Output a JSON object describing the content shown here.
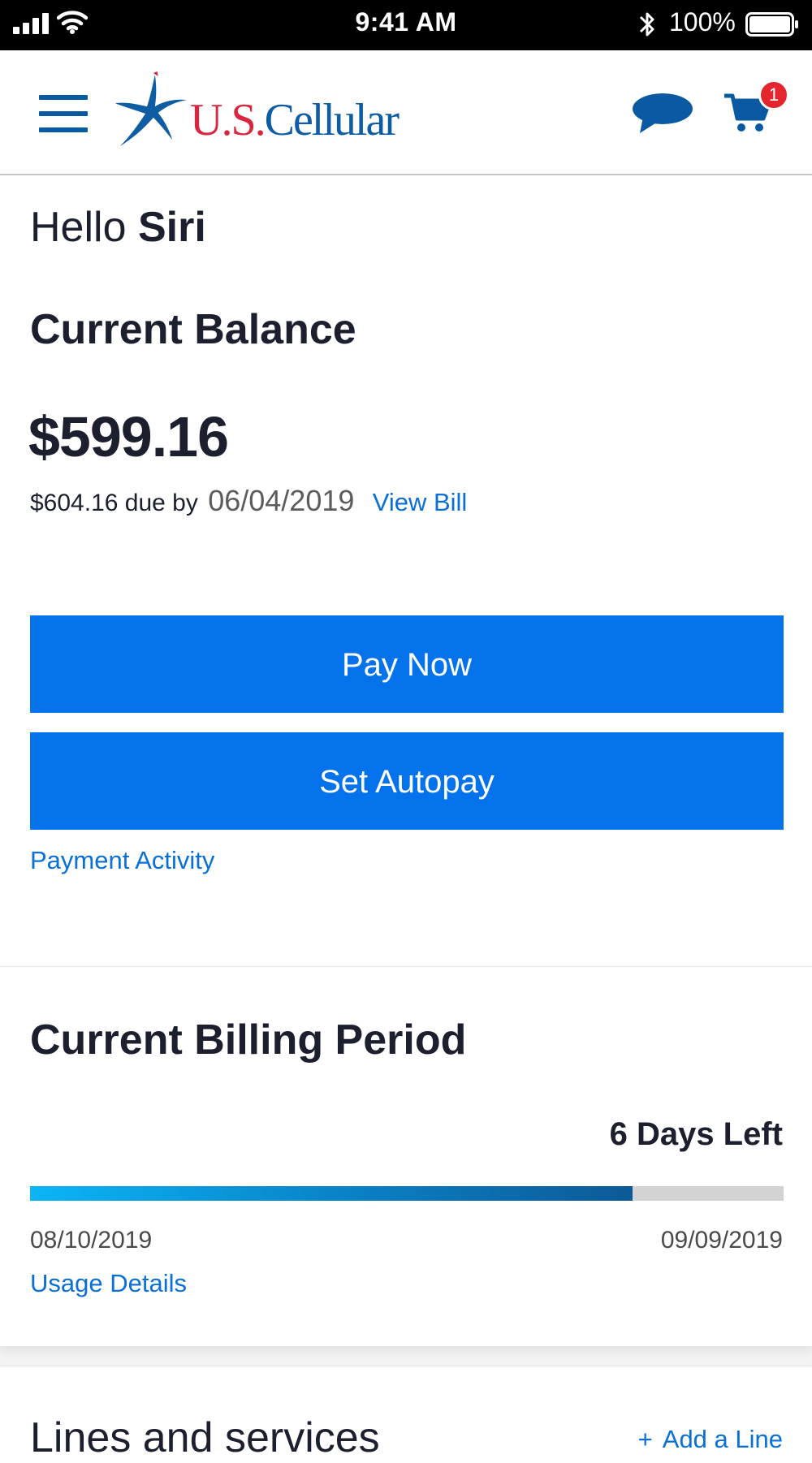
{
  "status_bar": {
    "time": "9:41 AM",
    "battery": "100%"
  },
  "header": {
    "logo_prefix": "U.S.",
    "logo_suffix": "Cellular",
    "cart_count": "1",
    "icons": [
      "menu-icon",
      "star-logo-icon",
      "chat-icon",
      "cart-icon"
    ],
    "colors": {
      "brand_blue": "#0d5ca4",
      "brand_red": "#d7263d",
      "badge": "#e5252e"
    }
  },
  "greeting": {
    "prefix": "Hello",
    "name": "Siri"
  },
  "balance": {
    "title": "Current Balance",
    "amount": "$599.16",
    "due_text": "$604.16 due by",
    "due_date": "06/04/2019",
    "view_bill_label": "View Bill",
    "pay_now_label": "Pay Now",
    "autopay_label": "Set Autopay",
    "payment_activity_label": "Payment Activity"
  },
  "billing": {
    "title": "Current Billing Period",
    "days_left": "6 Days Left",
    "progress_fraction": 0.8,
    "start_date": "08/10/2019",
    "end_date": "09/09/2019",
    "usage_details_label": "Usage Details"
  },
  "lines": {
    "title": "Lines and services",
    "add_line_label": "Add a Line"
  },
  "colors": {
    "button": "#0473eb",
    "link": "#0a6fd6"
  }
}
